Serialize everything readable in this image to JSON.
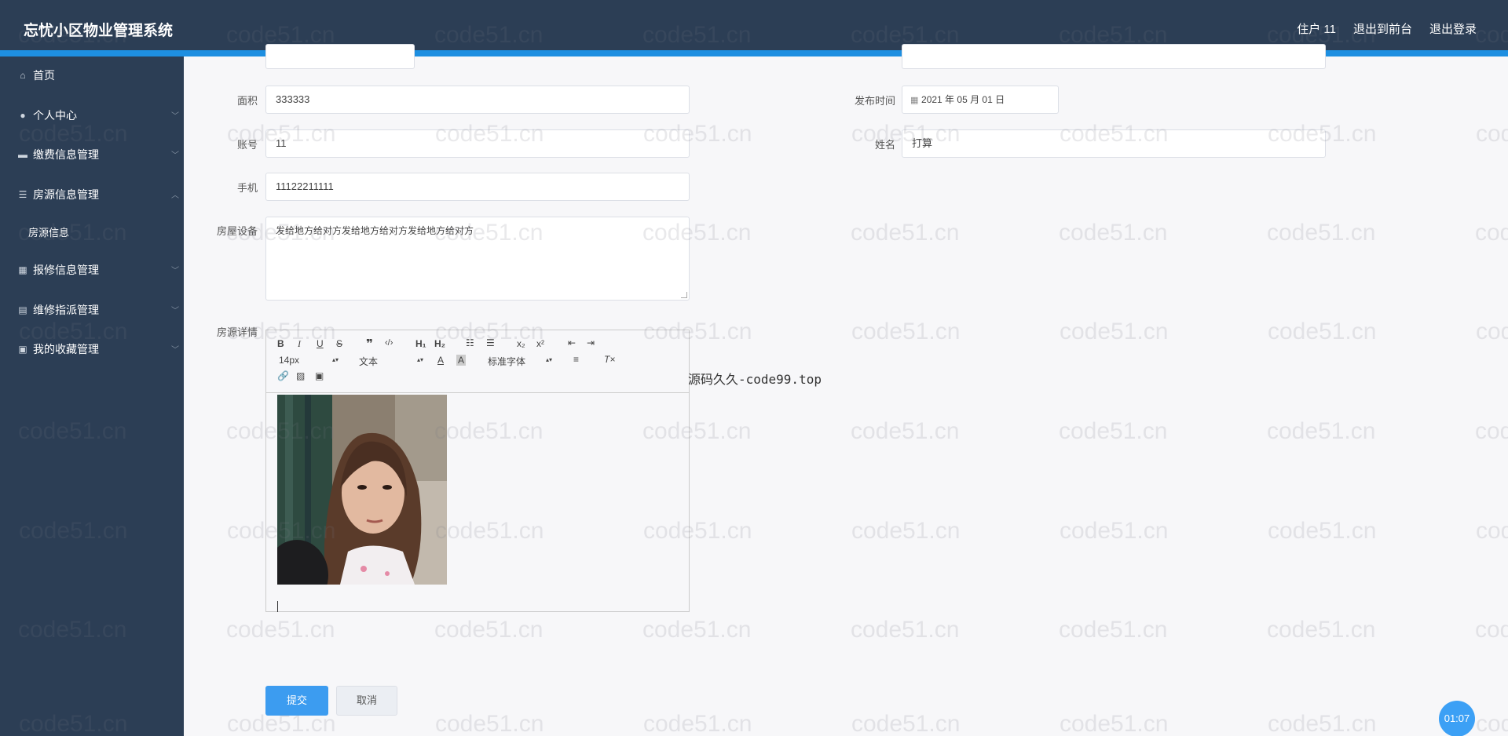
{
  "header": {
    "brand": "忘忧小区物业管理系统",
    "user": "住户 11",
    "to_front": "退出到前台",
    "logout": "退出登录"
  },
  "sidebar": {
    "items": [
      {
        "label": "首页",
        "icon": "home-icon"
      },
      {
        "label": "个人中心",
        "icon": "user-icon"
      },
      {
        "label": "缴费信息管理",
        "icon": "briefcase-icon"
      },
      {
        "label": "房源信息管理",
        "icon": "list-icon"
      },
      {
        "label": "报修信息管理",
        "icon": "grid-icon"
      },
      {
        "label": "维修指派管理",
        "icon": "clipboard-icon"
      },
      {
        "label": "我的收藏管理",
        "icon": "collection-icon"
      }
    ],
    "subitem": "房源信息"
  },
  "form": {
    "area_label": "面积",
    "area_value": "333333",
    "publish_label": "发布时间",
    "publish_value": "2021 年 05 月 01 日",
    "account_label": "账号",
    "account_value": "11",
    "name_label": "姓名",
    "name_value": "打算",
    "phone_label": "手机",
    "phone_value": "11122211111",
    "equipment_label": "房屋设备",
    "equipment_value": "发给地方给对方发给地方给对方发给地方给对方",
    "detail_label": "房源详情"
  },
  "editor": {
    "font_size": "14px",
    "heading": "文本",
    "font_family": "标准字体"
  },
  "side_note": "源码久久-code99.top",
  "buttons": {
    "submit": "提交",
    "cancel": "取消"
  },
  "timer": "01:07",
  "watermark": "code51.cn"
}
